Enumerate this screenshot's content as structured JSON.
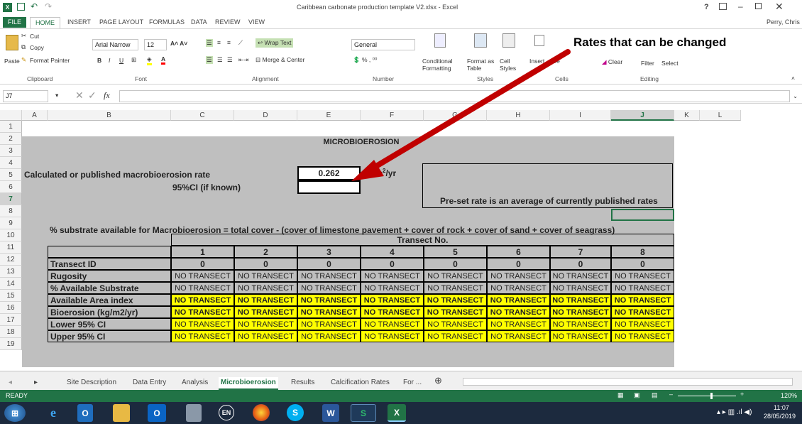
{
  "window": {
    "title": "Caribbean carbonate production template V2.xlsx - Excel",
    "user": "Perry, Chris",
    "help": "?"
  },
  "ribbon_tabs": [
    "FILE",
    "HOME",
    "INSERT",
    "PAGE LAYOUT",
    "FORMULAS",
    "DATA",
    "REVIEW",
    "VIEW"
  ],
  "ribbon": {
    "cut": "Cut",
    "copy": "Copy",
    "paste": "Paste",
    "format_painter": "Format Painter",
    "clipboard": "Clipboard",
    "font_name": "Arial Narrow",
    "font_size": "12",
    "font": "Font",
    "wrap_text": "Wrap Text",
    "merge_center": "Merge & Center",
    "alignment": "Alignment",
    "number_format": "General",
    "number": "Number",
    "conditional": "Conditional",
    "formatting": "Formatting",
    "format_as": "Format as",
    "table": "Table",
    "cell_styles": "Cell",
    "styles_word": "Styles",
    "styles": "Styles",
    "insert": "Insert",
    "delete": "De",
    "cells": "Cells",
    "clear": "Clear",
    "filter": "Filter",
    "select": "Select",
    "editing": "Editing",
    "bold": "B",
    "italic": "I",
    "underline": "U"
  },
  "annotation": {
    "text": "Rates that can be changed",
    "color": "#c00000"
  },
  "formula_bar": {
    "name_box": "J7",
    "fx": "fx",
    "value": ""
  },
  "columns": [
    "A",
    "B",
    "C",
    "D",
    "E",
    "F",
    "G",
    "H",
    "I",
    "J",
    "K",
    "L"
  ],
  "rows": [
    "1",
    "2",
    "3",
    "4",
    "5",
    "6",
    "7",
    "8",
    "9",
    "10",
    "11",
    "12",
    "13",
    "14",
    "15",
    "16",
    "17",
    "18",
    "19"
  ],
  "sheet": {
    "title": "MICROBIOEROSION",
    "rate_label": "Calculated or published macrobioerosion rate",
    "rate_value": "0.262",
    "rate_unit": "kg/m",
    "rate_unit_sup": "2",
    "rate_unit_tail": "/yr",
    "ci_label": "95%CI (if known)",
    "preset_note": "Pre-set rate is an average of currently published rates",
    "substrate_note": "% substrate available for Macrobioerosion = total cover - (cover of limestone pavement + cover of rock + cover of sand + cover of seagrass)",
    "transect_header": "Transect No.",
    "transects": [
      "1",
      "2",
      "3",
      "4",
      "5",
      "6",
      "7",
      "8"
    ],
    "table_rows": [
      {
        "label": "Transect ID",
        "values": [
          "0",
          "0",
          "0",
          "0",
          "0",
          "0",
          "0",
          "0"
        ],
        "style": "zero"
      },
      {
        "label": "Rugosity",
        "values": [
          "NO TRANSECT",
          "NO TRANSECT",
          "NO TRANSECT",
          "NO TRANSECT",
          "NO TRANSECT",
          "NO TRANSECT",
          "NO TRANSECT",
          "NO TRANSECT"
        ],
        "style": "plain"
      },
      {
        "label": "% Available Substrate",
        "values": [
          "NO TRANSECT",
          "NO TRANSECT",
          "NO TRANSECT",
          "NO TRANSECT",
          "NO TRANSECT",
          "NO TRANSECT",
          "NO TRANSECT",
          "NO TRANSECT"
        ],
        "style": "plain"
      },
      {
        "label": "Available Area index",
        "values": [
          "NO TRANSECT",
          "NO TRANSECT",
          "NO TRANSECT",
          "NO TRANSECT",
          "NO TRANSECT",
          "NO TRANSECT",
          "NO TRANSECT",
          "NO TRANSECT"
        ],
        "style": "yellow-bold"
      },
      {
        "label": "Bioerosion (kg/m2/yr)",
        "values": [
          "NO TRANSECT",
          "NO TRANSECT",
          "NO TRANSECT",
          "NO TRANSECT",
          "NO TRANSECT",
          "NO TRANSECT",
          "NO TRANSECT",
          "NO TRANSECT"
        ],
        "style": "yellow-bold"
      },
      {
        "label": "Lower 95% CI",
        "values": [
          "NO TRANSECT",
          "NO TRANSECT",
          "NO TRANSECT",
          "NO TRANSECT",
          "NO TRANSECT",
          "NO TRANSECT",
          "NO TRANSECT",
          "NO TRANSECT"
        ],
        "style": "yellow"
      },
      {
        "label": "Upper 95% CI",
        "values": [
          "NO TRANSECT",
          "NO TRANSECT",
          "NO TRANSECT",
          "NO TRANSECT",
          "NO TRANSECT",
          "NO TRANSECT",
          "NO TRANSECT",
          "NO TRANSECT"
        ],
        "style": "yellow"
      }
    ]
  },
  "sheet_tabs": [
    "Site Description",
    "Data Entry",
    "Analysis",
    "Microbioerosion",
    "Results",
    "Calcification Rates",
    "For ..."
  ],
  "active_sheet": "Microbioerosion",
  "status": {
    "ready": "READY",
    "zoom": "120%"
  },
  "taskbar": {
    "time": "11:07",
    "date": "28/05/2019",
    "lang": "EN"
  },
  "colors": {
    "excel_green": "#217346",
    "sheet_gray": "#bfbfbf",
    "highlight_yellow": "#ffff00"
  }
}
